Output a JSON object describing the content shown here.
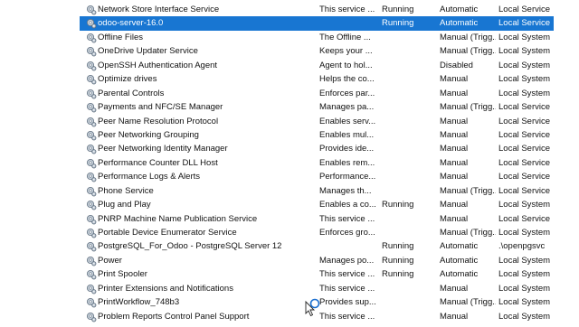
{
  "services": [
    {
      "name": "Network Store Interface Service",
      "description": "This service ...",
      "status": "Running",
      "startup": "Automatic",
      "logon": "Local Service"
    },
    {
      "name": "odoo-server-16.0",
      "description": "",
      "status": "Running",
      "startup": "Automatic",
      "logon": "Local Service",
      "selected": true
    },
    {
      "name": "Offline Files",
      "description": "The Offline ...",
      "status": "",
      "startup": "Manual (Trigg...",
      "logon": "Local System"
    },
    {
      "name": "OneDrive Updater Service",
      "description": "Keeps your ...",
      "status": "",
      "startup": "Manual (Trigg...",
      "logon": "Local System"
    },
    {
      "name": "OpenSSH Authentication Agent",
      "description": "Agent to hol...",
      "status": "",
      "startup": "Disabled",
      "logon": "Local System"
    },
    {
      "name": "Optimize drives",
      "description": "Helps the co...",
      "status": "",
      "startup": "Manual",
      "logon": "Local System"
    },
    {
      "name": "Parental Controls",
      "description": "Enforces par...",
      "status": "",
      "startup": "Manual",
      "logon": "Local System"
    },
    {
      "name": "Payments and NFC/SE Manager",
      "description": "Manages pa...",
      "status": "",
      "startup": "Manual (Trigg...",
      "logon": "Local Service"
    },
    {
      "name": "Peer Name Resolution Protocol",
      "description": "Enables serv...",
      "status": "",
      "startup": "Manual",
      "logon": "Local Service"
    },
    {
      "name": "Peer Networking Grouping",
      "description": "Enables mul...",
      "status": "",
      "startup": "Manual",
      "logon": "Local Service"
    },
    {
      "name": "Peer Networking Identity Manager",
      "description": "Provides ide...",
      "status": "",
      "startup": "Manual",
      "logon": "Local Service"
    },
    {
      "name": "Performance Counter DLL Host",
      "description": "Enables rem...",
      "status": "",
      "startup": "Manual",
      "logon": "Local Service"
    },
    {
      "name": "Performance Logs & Alerts",
      "description": "Performance...",
      "status": "",
      "startup": "Manual",
      "logon": "Local Service"
    },
    {
      "name": "Phone Service",
      "description": "Manages th...",
      "status": "",
      "startup": "Manual (Trigg...",
      "logon": "Local Service"
    },
    {
      "name": "Plug and Play",
      "description": "Enables a co...",
      "status": "Running",
      "startup": "Manual",
      "logon": "Local System"
    },
    {
      "name": "PNRP Machine Name Publication Service",
      "description": "This service ...",
      "status": "",
      "startup": "Manual",
      "logon": "Local Service"
    },
    {
      "name": "Portable Device Enumerator Service",
      "description": "Enforces gro...",
      "status": "",
      "startup": "Manual (Trigg...",
      "logon": "Local System"
    },
    {
      "name": "PostgreSQL_For_Odoo - PostgreSQL Server 12",
      "description": "",
      "status": "Running",
      "startup": "Automatic",
      ".\\openpgsvc": "",
      "logon": ".\\openpgsvc"
    },
    {
      "name": "Power",
      "description": "Manages po...",
      "status": "Running",
      "startup": "Automatic",
      "logon": "Local System"
    },
    {
      "name": "Print Spooler",
      "description": "This service ...",
      "status": "Running",
      "startup": "Automatic",
      "logon": "Local System"
    },
    {
      "name": "Printer Extensions and Notifications",
      "description": "This service ...",
      "status": "",
      "startup": "Manual",
      "logon": "Local System"
    },
    {
      "name": "PrintWorkflow_748b3",
      "description": "Provides sup...",
      "status": "",
      "startup": "Manual (Trigg...",
      "logon": "Local System"
    },
    {
      "name": "Problem Reports Control Panel Support",
      "description": "This service ...",
      "status": "",
      "startup": "Manual",
      "logon": "Local System"
    }
  ]
}
